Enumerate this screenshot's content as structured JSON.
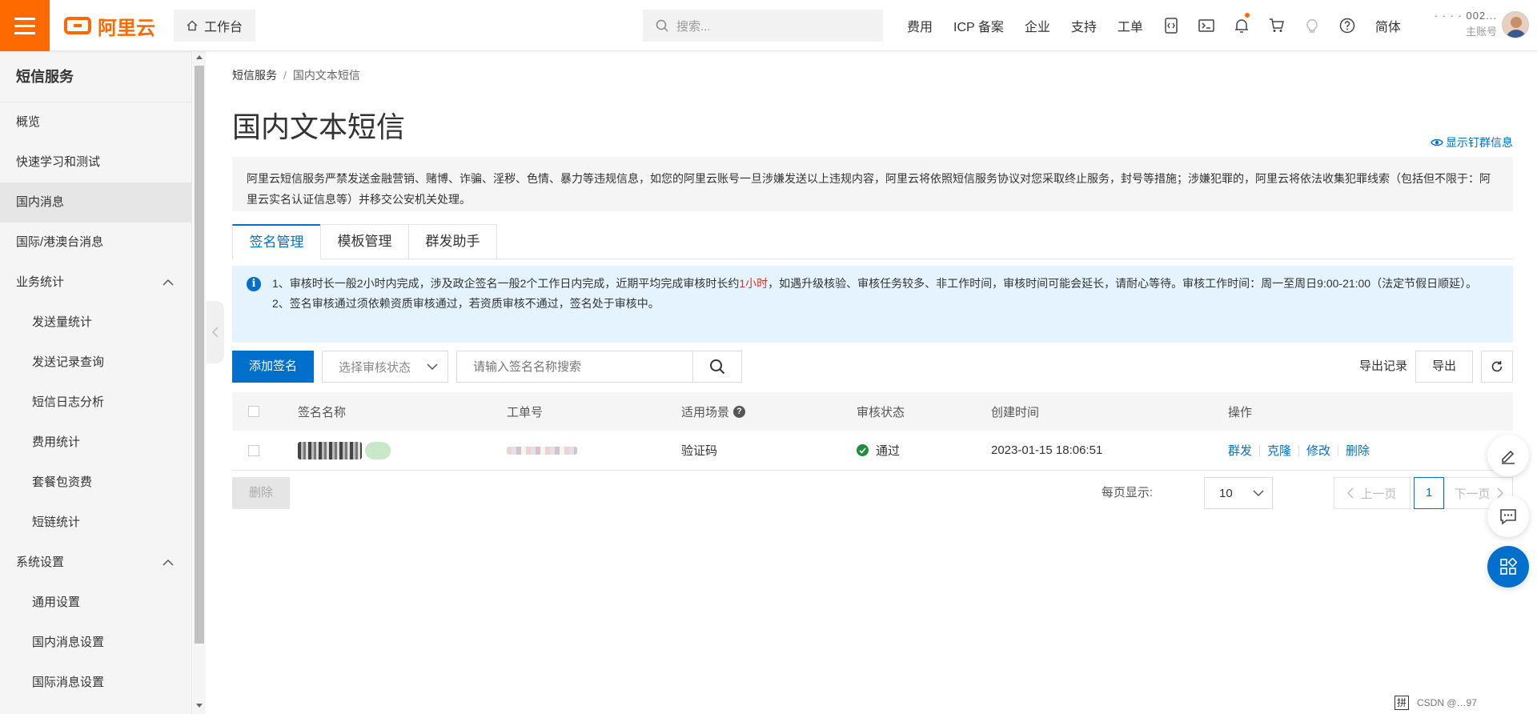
{
  "topbar": {
    "logo_text": "阿里云",
    "workbench_label": "工作台",
    "search_placeholder": "搜索...",
    "nav_items": [
      "费用",
      "ICP 备案",
      "企业",
      "支持",
      "工单"
    ],
    "lang_label": "简体",
    "account_name": "· ·  · ·  002...",
    "account_role": "主账号",
    "accent": "#ff6a00"
  },
  "sidebar": {
    "title": "短信服务",
    "items": [
      {
        "label": "概览"
      },
      {
        "label": "快速学习和测试"
      },
      {
        "label": "国内消息",
        "active": true
      },
      {
        "label": "国际/港澳台消息"
      },
      {
        "label": "业务统计",
        "expanded": true
      },
      {
        "label": "发送量统计",
        "sub": true
      },
      {
        "label": "发送记录查询",
        "sub": true
      },
      {
        "label": "短信日志分析",
        "sub": true
      },
      {
        "label": "费用统计",
        "sub": true
      },
      {
        "label": "套餐包资费",
        "sub": true
      },
      {
        "label": "短链统计",
        "sub": true
      },
      {
        "label": "系统设置",
        "expanded": true
      },
      {
        "label": "通用设置",
        "sub": true
      },
      {
        "label": "国内消息设置",
        "sub": true
      },
      {
        "label": "国际消息设置",
        "sub": true
      }
    ]
  },
  "breadcrumb": {
    "root": "短信服务",
    "separator": "/",
    "current": "国内文本短信"
  },
  "page_title": "国内文本短信",
  "subscribe_link": "显示钉群信息",
  "notice": "阿里云短信服务严禁发送金融营销、赌博、诈骗、淫秽、色情、暴力等违规信息，如您的阿里云账号一旦涉嫌发送以上违规内容，阿里云将依照短信服务协议对您采取终止服务，封号等措施；涉嫌犯罪的，阿里云将依法收集犯罪线索（包括但不限于：阿里云实名认证信息等）并移交公安机关处理。",
  "tabs": [
    {
      "label": "签名管理",
      "active": true
    },
    {
      "label": "模板管理"
    },
    {
      "label": "群发助手"
    }
  ],
  "info": {
    "line1_a": "1、审核时长一般2小时内完成，涉及政企签名一般2个工作日内完成，近期平均完成审核时长约",
    "line1_highlight": "1小时",
    "line1_b": "，如遇升级核验、审核任务较多、非工作时间，审核时间可能会延长，请耐心等待。审核工作时间：周一至周日9:00-21:00（法定节假日顺延）。",
    "line2": "2、签名审核通过须依赖资质审核通过，若资质审核不通过，签名处于审核中。"
  },
  "toolbar": {
    "add_label": "添加签名",
    "status_select": "选择审核状态",
    "search_placeholder": "请输入签名名称搜索",
    "export_log": "导出记录",
    "export": "导出"
  },
  "table": {
    "headers": [
      "签名名称",
      "工单号",
      "适用场景",
      "审核状态",
      "创建时间",
      "操作"
    ],
    "rows": [
      {
        "scene": "验证码",
        "status": "通过",
        "created": "2023-01-15 18:06:51",
        "ops": [
          "群发",
          "克隆",
          "修改",
          "删除"
        ]
      }
    ]
  },
  "footer": {
    "delete_label": "删除",
    "page_size_label": "每页显示:",
    "page_size": "10",
    "prev": "上一页",
    "current_page": "1",
    "next": "下一页"
  },
  "ime": {
    "label": "拼",
    "watermark": "CSDN @…97"
  },
  "colors": {
    "primary": "#0070cc",
    "success": "#1e8e3e",
    "highlight": "#d93026"
  }
}
